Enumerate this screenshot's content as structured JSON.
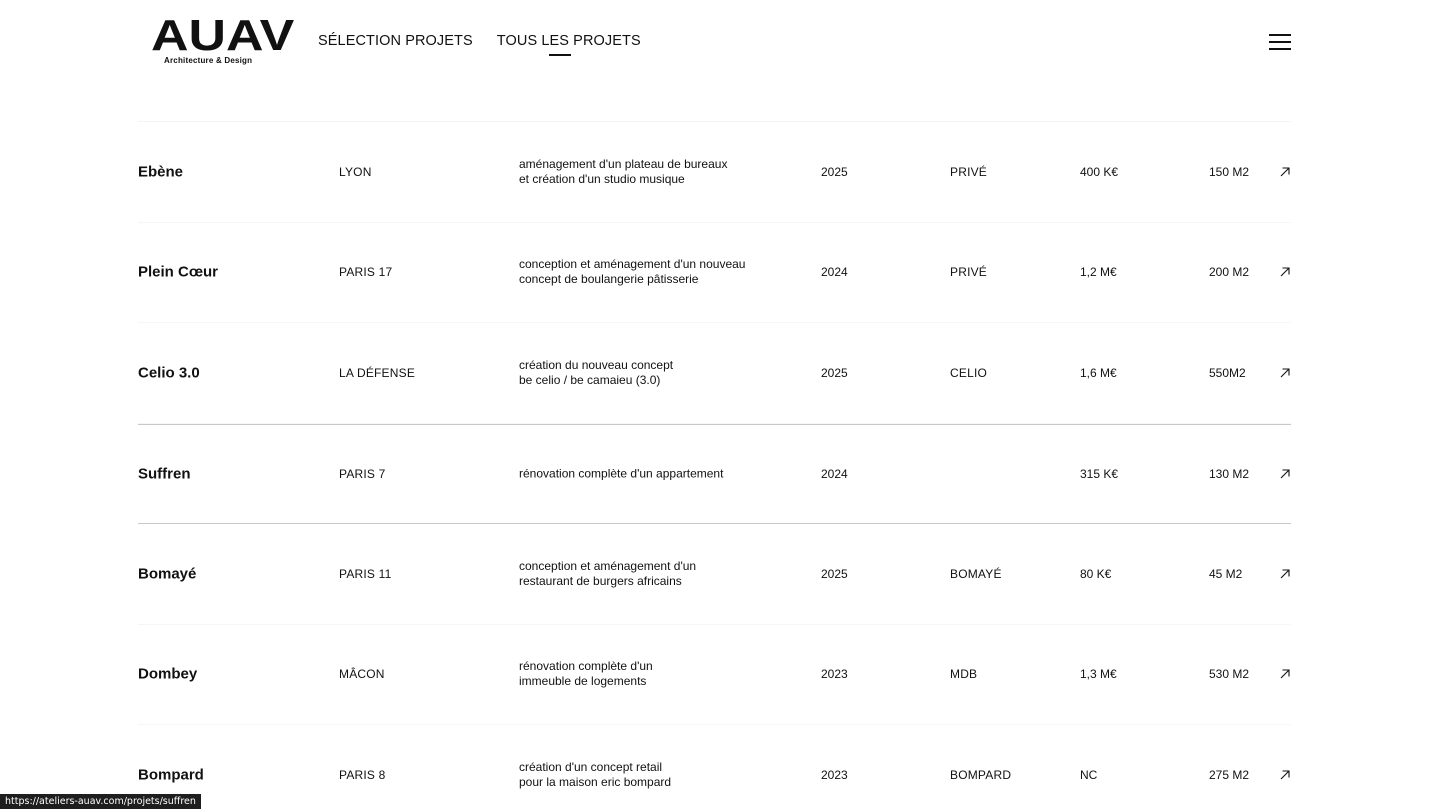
{
  "logo": {
    "mark": "AUAV",
    "subtitle": "Architecture & Design"
  },
  "nav": [
    {
      "label": "SÉLECTION PROJETS",
      "active": false
    },
    {
      "label": "TOUS LES PROJETS",
      "active": true
    }
  ],
  "menu": {
    "icon": "hamburger-menu-icon"
  },
  "projects": [
    {
      "name": "Ebène",
      "location": "LYON",
      "description_lines": [
        "aménagement d'un plateau de bureaux",
        "et création d'un studio musique"
      ],
      "year": "2025",
      "client": "PRIVÉ",
      "budget": "400 K€",
      "area": "150 M2",
      "icon": "arrow-up-right-icon"
    },
    {
      "name": "Plein Cœur",
      "location": "PARIS 17",
      "description_lines": [
        "conception et aménagement d'un nouveau",
        "concept de boulangerie pâtisserie"
      ],
      "year": "2024",
      "client": "PRIVÉ",
      "budget": "1,2 M€",
      "area": "200 M2",
      "icon": "arrow-up-right-icon"
    },
    {
      "name": "Celio 3.0",
      "location": "LA DÉFENSE",
      "description_lines": [
        "création du nouveau concept",
        "be celio / be camaieu (3.0)"
      ],
      "year": "2025",
      "client": "CELIO",
      "budget": "1,6 M€",
      "area": "550M2",
      "icon": "arrow-up-right-icon"
    },
    {
      "name": "Suffren",
      "location": "PARIS 7",
      "description_lines": [
        "rénovation complète d'un appartement"
      ],
      "year": "2024",
      "client": "",
      "budget": "315 K€",
      "area": "130 M2",
      "icon": "arrow-up-right-icon",
      "hovered": true
    },
    {
      "name": "Bomayé",
      "location": "PARIS 11",
      "description_lines": [
        "conception et aménagement d'un",
        "restaurant de burgers africains"
      ],
      "year": "2025",
      "client": "BOMAYÉ",
      "budget": "80 K€",
      "area": "45 M2",
      "icon": "arrow-up-right-icon"
    },
    {
      "name": "Dombey",
      "location": "MÂCON",
      "description_lines": [
        "rénovation complète d'un",
        "immeuble de logements"
      ],
      "year": "2023",
      "client": "MDB",
      "budget": "1,3 M€",
      "area": "530 M2",
      "icon": "arrow-up-right-icon"
    },
    {
      "name": "Bompard",
      "location": "PARIS 8",
      "description_lines": [
        "création d'un concept retail",
        "pour la maison eric bompard"
      ],
      "year": "2023",
      "client": "BOMPARD",
      "budget": "NC",
      "area": "275 M2",
      "icon": "arrow-up-right-icon"
    }
  ],
  "status_bar": {
    "url": "https://ateliers-auav.com/projets/suffren"
  },
  "colors": {
    "text": "#111111",
    "background": "#ffffff",
    "divider_active": "#c9c9c9",
    "status_bg": "#1e1e1e"
  }
}
